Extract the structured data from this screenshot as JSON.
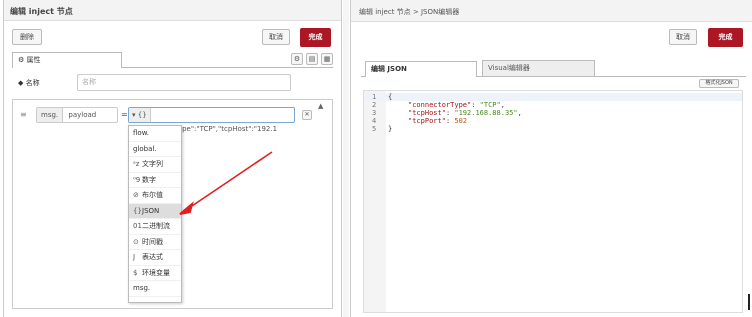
{
  "left": {
    "title": "编辑 inject 节点",
    "delete_label": "删除",
    "cancel_label": "取消",
    "done_label": "完成",
    "tab_properties": "属性",
    "name_label": "名称",
    "name_placeholder": "名称",
    "prop_type": "msg.",
    "prop_name": "payload",
    "equals": "=",
    "value_type_icon": "{}",
    "value_text": "{\"connectorType\":\"TCP\",\"tcpHost\":\"192.1",
    "dropdown": [
      {
        "icon": "",
        "label": "flow."
      },
      {
        "icon": "",
        "label": "global."
      },
      {
        "icon": "ᵃz",
        "label": "文字列"
      },
      {
        "icon": "⁰9",
        "label": "数字"
      },
      {
        "icon": "⊘",
        "label": "布尔值"
      },
      {
        "icon": "{}",
        "label": "JSON"
      },
      {
        "icon": "01",
        "label": "二进制流"
      },
      {
        "icon": "⊙",
        "label": "时间戳"
      },
      {
        "icon": "J",
        "label": "表达式"
      },
      {
        "icon": "$",
        "label": "环境变量"
      },
      {
        "icon": "",
        "label": "msg."
      }
    ],
    "selected_index": 5
  },
  "right": {
    "title": "编辑 inject 节点 > JSON编辑器",
    "cancel_label": "取消",
    "done_label": "完成",
    "tab_json": "编辑 JSON",
    "tab_visual": "Visual编辑器",
    "format_label": "格式化JSON",
    "code_lines": [
      {
        "num": "1",
        "text": "{"
      },
      {
        "num": "2",
        "key": "\"connectorType\"",
        "val": "\"TCP\"",
        "end": ","
      },
      {
        "num": "3",
        "key": "\"tcpHost\"",
        "val": "\"192.168.88.35\"",
        "end": ","
      },
      {
        "num": "4",
        "key": "\"tcpPort\"",
        "num_val": "502",
        "end": ""
      },
      {
        "num": "5",
        "text": "}"
      }
    ]
  },
  "colors": {
    "primary": "#ad1625",
    "arrow": "#e02020"
  }
}
